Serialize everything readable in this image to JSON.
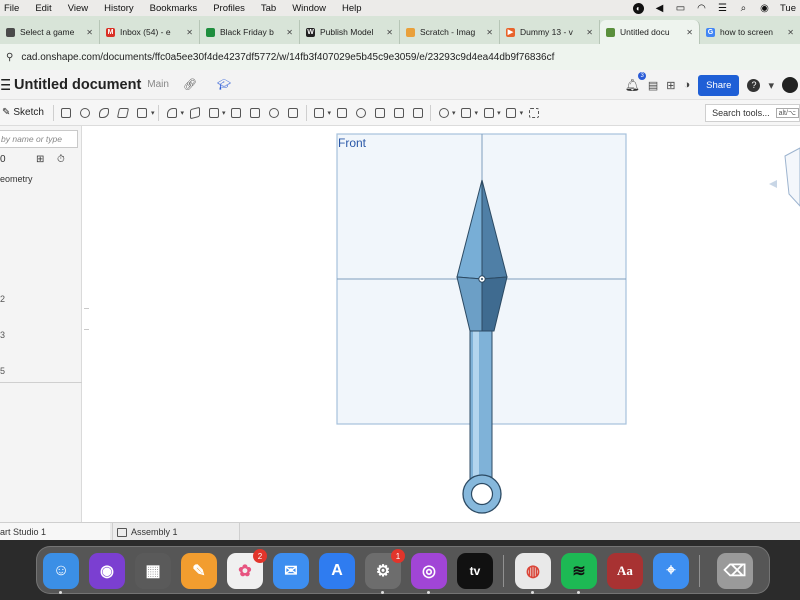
{
  "menubar": {
    "items": [
      "File",
      "Edit",
      "View",
      "History",
      "Bookmarks",
      "Profiles",
      "Tab",
      "Window",
      "Help"
    ],
    "clock": "Tue"
  },
  "tabs": [
    {
      "label": "Select a game",
      "favicon_color": "#4a4a4a",
      "active": false
    },
    {
      "label": "Inbox (54) - e",
      "favicon_color": "#d93025",
      "active": false
    },
    {
      "label": "Black Friday b",
      "favicon_color": "#1e8e3e",
      "active": false
    },
    {
      "label": "Publish Model",
      "favicon_color": "#222222",
      "active": false
    },
    {
      "label": "Scratch - Imag",
      "favicon_color": "#e9a03b",
      "active": false
    },
    {
      "label": "Dummy 13 - v",
      "favicon_color": "#e8632b",
      "active": false
    },
    {
      "label": "Untitled docu",
      "favicon_color": "#5a8f3c",
      "active": true
    },
    {
      "label": "how to screen",
      "favicon_color": "#4285f4",
      "active": false
    }
  ],
  "address": {
    "url": "cad.onshape.com/documents/ffc0a5ee30f4de4237df5772/w/14fb3f407029e5b45c9e3059/e/23293c9d4ea44db9f76836cf"
  },
  "header": {
    "title": "Untitled document",
    "branch": "Main",
    "notifications": "3",
    "share_label": "Share"
  },
  "toolbar": {
    "sketch_label": "Sketch",
    "search_label": "Search tools...",
    "search_shortcut": "alt/⌥"
  },
  "panel": {
    "filter_placeholder": "by name or type",
    "geometry_label": "eometry",
    "left_digits": [
      "0",
      "2",
      "3",
      "5"
    ]
  },
  "viewport": {
    "plane_label": "Front"
  },
  "bottom_tabs": {
    "part_studio": "art Studio 1",
    "assembly": "Assembly 1"
  },
  "dock": {
    "apps": [
      {
        "name": "finder",
        "glyph": "☺",
        "color": "#3b8fe6"
      },
      {
        "name": "siri",
        "glyph": "◉",
        "color": "#7b3fd1"
      },
      {
        "name": "launchpad",
        "glyph": "▦",
        "color": "#5a5a5a"
      },
      {
        "name": "pages",
        "glyph": "✎",
        "color": "#f29d2f"
      },
      {
        "name": "photos",
        "glyph": "✿",
        "color": "#f0f0f0",
        "badge": "2"
      },
      {
        "name": "mail",
        "glyph": "✉",
        "color": "#3d8ef0"
      },
      {
        "name": "app-store",
        "glyph": "A",
        "color": "#2f7cf0"
      },
      {
        "name": "system-settings",
        "glyph": "⚙",
        "color": "#6d6d6d",
        "badge": "1"
      },
      {
        "name": "podcasts",
        "glyph": "◎",
        "color": "#a145d6"
      },
      {
        "name": "apple-tv",
        "glyph": "tv",
        "color": "#111111"
      },
      {
        "name": "chrome",
        "glyph": "◍",
        "color": "#e9e9e9"
      },
      {
        "name": "spotify",
        "glyph": "≋",
        "color": "#1db954"
      },
      {
        "name": "dictionary",
        "glyph": "Aa",
        "color": "#a83232"
      },
      {
        "name": "safari",
        "glyph": "⌖",
        "color": "#3d8ef0"
      },
      {
        "name": "trash",
        "glyph": "⌫",
        "color": "#9a9a9a"
      }
    ]
  },
  "colors": {
    "accent": "#1f5fd6",
    "model_fill": "#87b9dc",
    "model_stroke": "#2c4a63",
    "plane_fill": "#f1f6fb",
    "plane_stroke": "#a6c1dd"
  }
}
